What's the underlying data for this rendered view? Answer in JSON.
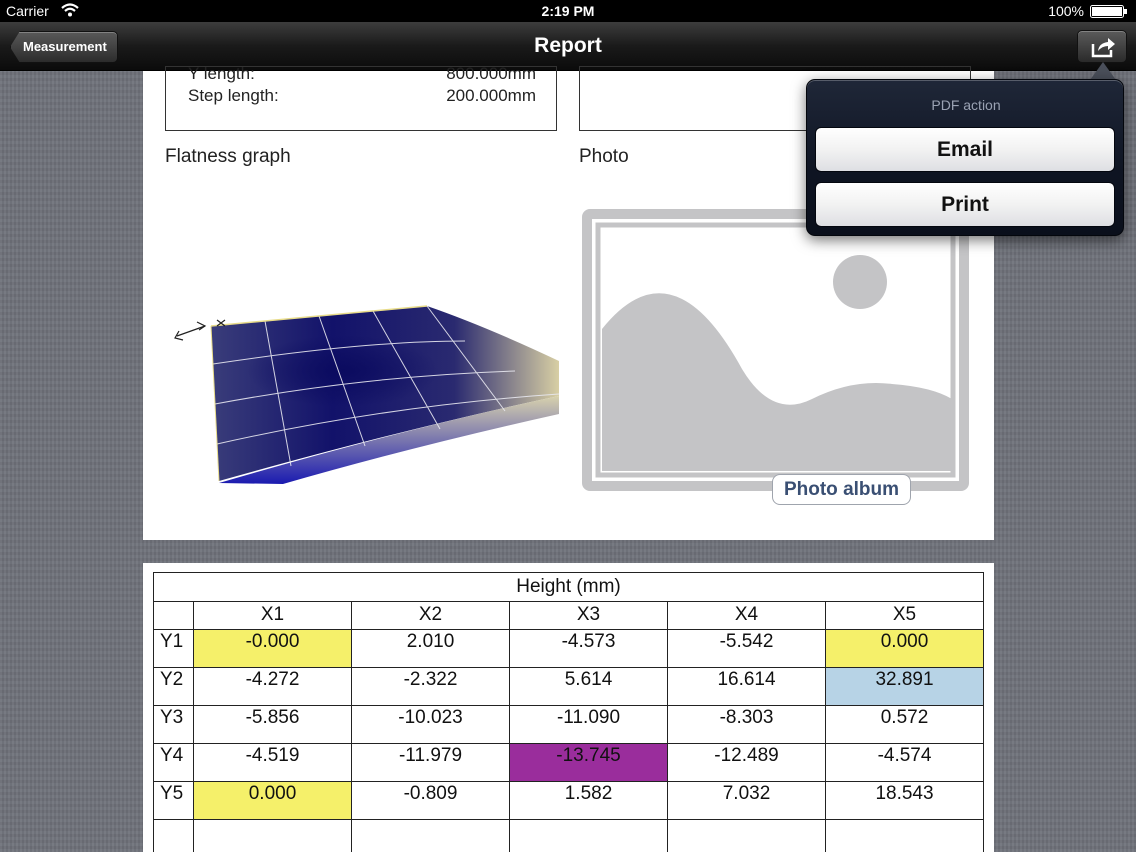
{
  "status_bar": {
    "carrier": "Carrier",
    "time": "2:19 PM",
    "battery": "100%"
  },
  "nav": {
    "back_label": "Measurement",
    "title": "Report",
    "action_icon": "share-icon"
  },
  "report": {
    "info": [
      {
        "label": "Y length:",
        "value": "800.000mm"
      },
      {
        "label": "Step length:",
        "value": "200.000mm"
      }
    ],
    "graph_label": "Flatness graph",
    "photo_label": "Photo",
    "photo_album_label": "Photo album"
  },
  "popover": {
    "title": "PDF action",
    "email_label": "Email",
    "print_label": "Print"
  },
  "height_table": {
    "caption": "Height (mm)",
    "columns": [
      "X1",
      "X2",
      "X3",
      "X4",
      "X5"
    ],
    "rows": [
      {
        "label": "Y1",
        "values": [
          "-0.000",
          "2.010",
          "-4.573",
          "-5.542",
          "0.000"
        ]
      },
      {
        "label": "Y2",
        "values": [
          "-4.272",
          "-2.322",
          "5.614",
          "16.614",
          "32.891"
        ]
      },
      {
        "label": "Y3",
        "values": [
          "-5.856",
          "-10.023",
          "-11.090",
          "-8.303",
          "0.572"
        ]
      },
      {
        "label": "Y4",
        "values": [
          "-4.519",
          "-11.979",
          "-13.745",
          "-12.489",
          "-4.574"
        ]
      },
      {
        "label": "Y5",
        "values": [
          "0.000",
          "-0.809",
          "1.582",
          "7.032",
          "18.543"
        ]
      }
    ],
    "highlight_colors": {
      "reference": "#f5f06a",
      "max": "#b7d3e6",
      "min": "#9a2d9c"
    }
  }
}
